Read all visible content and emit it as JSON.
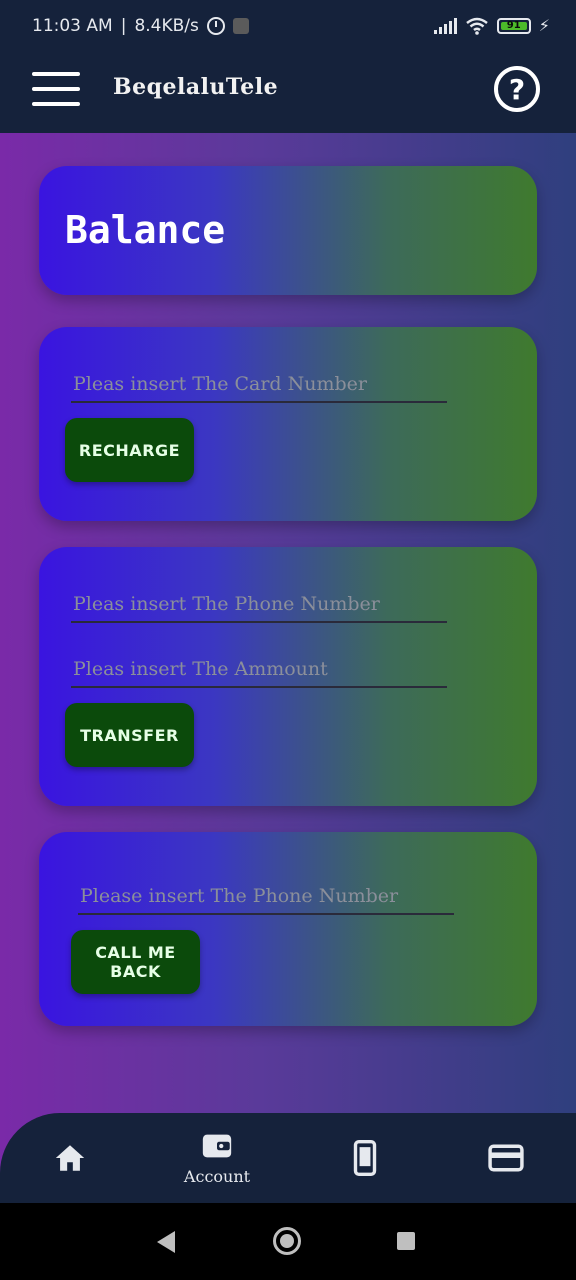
{
  "status_bar": {
    "time": "11:03 AM",
    "speed": "8.4KB/s",
    "battery": "91"
  },
  "app_bar": {
    "title": "BeqelaluTele"
  },
  "balance_card": {
    "title": "Balance"
  },
  "recharge_card": {
    "card_number_placeholder": "Pleas insert The Card Number",
    "button_label": "RECHARGE"
  },
  "transfer_card": {
    "phone_placeholder": "Pleas insert The Phone Number",
    "amount_placeholder": "Pleas insert The Ammount",
    "button_label": "TRANSFER"
  },
  "callback_card": {
    "phone_placeholder": "Please insert The Phone Number",
    "button_label": "CALL ME BACK"
  },
  "bottom_nav": {
    "items": [
      {
        "icon": "home-icon",
        "label": ""
      },
      {
        "icon": "wallet-icon",
        "label": "Account"
      },
      {
        "icon": "phone-device-icon",
        "label": ""
      },
      {
        "icon": "credit-card-icon",
        "label": ""
      }
    ]
  },
  "colors": {
    "app_bar": "#15223b",
    "button": "#0b4a0b",
    "card_start": "#3a14e0",
    "card_end": "#3f7a2e"
  }
}
